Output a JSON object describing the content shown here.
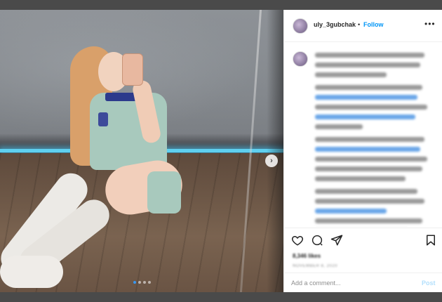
{
  "header": {
    "username": "uly_3gubchak",
    "separator": "•",
    "follow_label": "Follow",
    "more_glyph": "•••"
  },
  "photo": {
    "next_glyph": "›",
    "carousel_pages": 4,
    "carousel_active_index": 0
  },
  "caption": {
    "blurred": true,
    "line_widths_pct": [
      92,
      88,
      60,
      0,
      90,
      86,
      94,
      84,
      40,
      0,
      92,
      88,
      94,
      90,
      76,
      0,
      86,
      92,
      60,
      90,
      78
    ]
  },
  "actions": {
    "like_icon": "heart-icon",
    "comment_icon": "comment-icon",
    "share_icon": "share-icon",
    "save_icon": "bookmark-icon"
  },
  "stats": {
    "likes_text": "8,346 likes",
    "date_text": "NOVEMBER 8, 2020"
  },
  "comment": {
    "placeholder": "Add a comment...",
    "post_label": "Post"
  },
  "colors": {
    "accent": "#0095f6",
    "post_disabled": "#b2dffc",
    "led": "#5fd0f0"
  }
}
